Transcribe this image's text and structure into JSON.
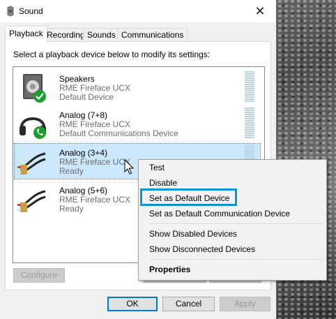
{
  "window": {
    "title": "Sound",
    "close_glyph": "✕"
  },
  "tabs": [
    {
      "label": "Playback",
      "active": true
    },
    {
      "label": "Recording"
    },
    {
      "label": "Sounds"
    },
    {
      "label": "Communications"
    }
  ],
  "instruction": "Select a playback device below to modify its settings:",
  "devices": [
    {
      "name": "Speakers",
      "driver": "RME Fireface UCX",
      "status": "Default Device",
      "icon": "speaker-icon",
      "badge": "check-icon",
      "badge_color": "#1e9d2e"
    },
    {
      "name": "Analog (7+8)",
      "driver": "RME Fireface UCX",
      "status": "Default Communications Device",
      "icon": "headphones-icon",
      "badge": "phone-icon",
      "badge_color": "#1e9d2e"
    },
    {
      "name": "Analog (3+4)",
      "driver": "RME Fireface UCX",
      "status": "Ready",
      "icon": "rca-cable-icon",
      "selected": true
    },
    {
      "name": "Analog (5+6)",
      "driver": "RME Fireface UCX",
      "status": "Ready",
      "icon": "rca-cable-icon"
    }
  ],
  "buttons": {
    "configure": "Configure",
    "ok": "OK",
    "cancel": "Cancel",
    "apply": "Apply"
  },
  "context_menu": {
    "items": [
      {
        "label": "Test"
      },
      {
        "label": "Disable"
      },
      {
        "label": "Set as Default Device",
        "highlighted": true
      },
      {
        "label": "Set as Default Communication Device"
      },
      {
        "label": "Show Disabled Devices"
      },
      {
        "label": "Show Disconnected Devices"
      },
      {
        "label": "Properties",
        "bold": true
      }
    ]
  },
  "colors": {
    "selection": "#cce8ff",
    "highlight_box": "#0a96d8",
    "focus": "#0078d7"
  }
}
